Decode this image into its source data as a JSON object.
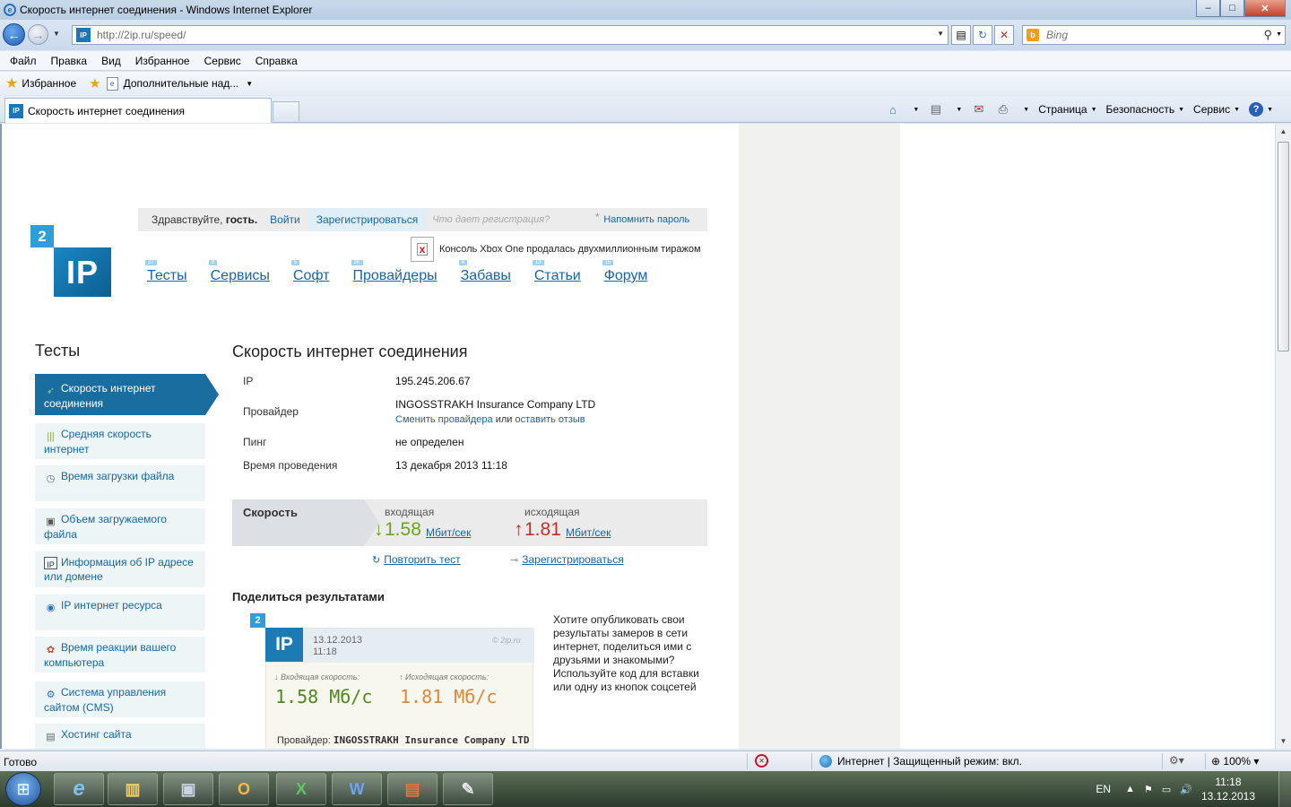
{
  "window": {
    "title": "Скорость интернет соединения - Windows Internet Explorer",
    "min": "–",
    "max": "□",
    "close": "✕"
  },
  "address": {
    "url": "http://2ip.ru/speed/",
    "search_placeholder": "Bing"
  },
  "menu": [
    "Файл",
    "Правка",
    "Вид",
    "Избранное",
    "Сервис",
    "Справка"
  ],
  "favorites": {
    "label": "Избранное",
    "addon": "Дополнительные над..."
  },
  "tab": {
    "title": "Скорость интернет соединения"
  },
  "commandbar": {
    "page": "Страница",
    "safety": "Безопасность",
    "tools": "Сервис"
  },
  "site": {
    "logo_badge": "2",
    "logo_text": "IP",
    "greeting_prefix": "Здравствуйте,",
    "greeting_name": "гость.",
    "login": "Войти",
    "register": "Зарегистрироваться",
    "why_register": "Что дает регистрация?",
    "remind_password": "Напомнить пароль",
    "news": "Консоль Xbox One продалась двухмиллионным тиражом",
    "nav": [
      {
        "label": "Тесты",
        "count": "27"
      },
      {
        "label": "Сервисы",
        "count": "9"
      },
      {
        "label": "Софт",
        "count": "5"
      },
      {
        "label": "Провайдеры",
        "count": "2K"
      },
      {
        "label": "Забавы",
        "count": "4"
      },
      {
        "label": "Статьи",
        "count": "13"
      },
      {
        "label": "Форум",
        "count": "15"
      }
    ]
  },
  "sidebar": {
    "title": "Тесты",
    "items": [
      {
        "label": "Скорость интернет соединения"
      },
      {
        "label": "Средняя скорость интернет"
      },
      {
        "label": "Время загрузки файла"
      },
      {
        "label": "Объем загружаемого файла"
      },
      {
        "label": "Информация об IP адресе или домене"
      },
      {
        "label": "IP интернет ресурса"
      },
      {
        "label": "Время реакции вашего компьютера"
      },
      {
        "label": "Система управления сайтом (CMS)"
      },
      {
        "label": "Хостинг сайта"
      }
    ]
  },
  "main": {
    "title": "Скорость интернет соединения",
    "ip_label": "IP",
    "ip_value": "195.245.206.67",
    "provider_label": "Провайдер",
    "provider_value": "INGOSSTRAKH Insurance Company LTD",
    "change_provider": "Сменить провайдера",
    "or": "или",
    "leave_review": "оставить отзыв",
    "ping_label": "Пинг",
    "ping_value": "не определен",
    "time_label": "Время проведения",
    "time_value": "13 декабря 2013 11:18",
    "speed_label": "Скорость",
    "incoming_label": "входящая",
    "incoming_value": "1.58",
    "outgoing_label": "исходящая",
    "outgoing_value": "1.81",
    "unit": "Мбит/сек",
    "repeat_test": "Повторить тест",
    "register": "Зарегистрироваться",
    "share_title": "Поделиться результатами",
    "share_text": "Хотите опубликовать свои результаты замеров в сети интернет, поделиться ими с друзьями и знакомыми? Используйте код для вставки или одну из кнопок соцсетей"
  },
  "card": {
    "badge": "2",
    "logo": "IP",
    "date": "13.12.2013",
    "time": "11:18",
    "site": "© 2ip.ru",
    "in_label": "Входящая скорость:",
    "in_value": "1.58 Мб/с",
    "out_label": "Исходящая скорость:",
    "out_value": "1.81 Мб/с",
    "provider_label": "Провайдер:",
    "provider_value": "INGOSSTRAKH Insurance Company LTD"
  },
  "status": {
    "ready": "Готово",
    "zone": "Интернет | Защищенный режим: вкл.",
    "zoom": "100%"
  },
  "taskbar": {
    "lang": "EN",
    "time": "11:18",
    "date": "13.12.2013"
  },
  "colors": {
    "brand": "#1a6d9f",
    "incoming": "#6aa31e",
    "outgoing": "#c3302c",
    "link": "#1765a8"
  }
}
